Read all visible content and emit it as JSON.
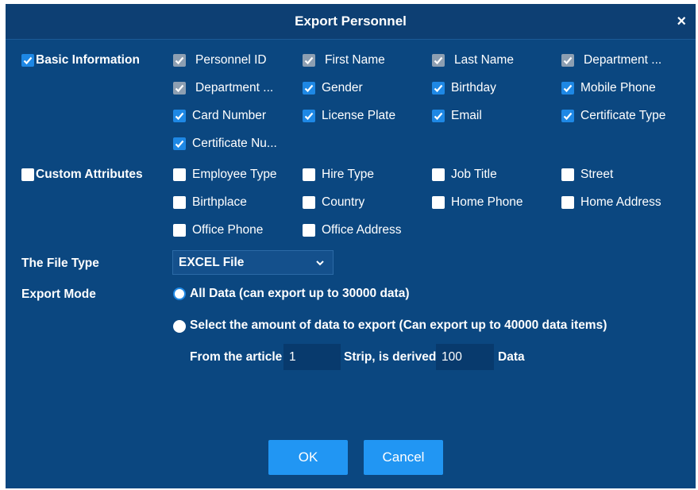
{
  "dialog": {
    "title": "Export Personnel",
    "close_symbol": "×"
  },
  "basic": {
    "label": "Basic Information",
    "checked": true,
    "fields": [
      {
        "label": "Personnel ID",
        "state": "disabled"
      },
      {
        "label": "First Name",
        "state": "disabled"
      },
      {
        "label": "Last Name",
        "state": "disabled"
      },
      {
        "label": "Department ...",
        "state": "disabled"
      },
      {
        "label": "Department ...",
        "state": "disabled"
      },
      {
        "label": "Gender",
        "state": "checked"
      },
      {
        "label": "Birthday",
        "state": "checked"
      },
      {
        "label": "Mobile Phone",
        "state": "checked"
      },
      {
        "label": "Card Number",
        "state": "checked"
      },
      {
        "label": "License Plate",
        "state": "checked"
      },
      {
        "label": "Email",
        "state": "checked"
      },
      {
        "label": "Certificate Type",
        "state": "checked"
      },
      {
        "label": "Certificate Nu...",
        "state": "checked"
      }
    ]
  },
  "custom": {
    "label": "Custom Attributes",
    "checked": false,
    "fields": [
      {
        "label": "Employee Type",
        "state": "unchecked"
      },
      {
        "label": "Hire Type",
        "state": "unchecked"
      },
      {
        "label": "Job Title",
        "state": "unchecked"
      },
      {
        "label": "Street",
        "state": "unchecked"
      },
      {
        "label": "Birthplace",
        "state": "unchecked"
      },
      {
        "label": "Country",
        "state": "unchecked"
      },
      {
        "label": "Home Phone",
        "state": "unchecked"
      },
      {
        "label": "Home Address",
        "state": "unchecked"
      },
      {
        "label": "Office Phone",
        "state": "unchecked"
      },
      {
        "label": "Office Address",
        "state": "unchecked"
      }
    ]
  },
  "file_type": {
    "label": "The File Type",
    "value": "EXCEL File",
    "icon": "chevron-down-icon"
  },
  "export_mode": {
    "label": "Export Mode",
    "options": [
      {
        "label": "All Data (can export up to 30000 data)",
        "selected": true
      },
      {
        "label": "Select the amount of data to export (Can export up to 40000 data items)",
        "selected": false
      }
    ],
    "range": {
      "from_label": "From the article",
      "from_value": "1",
      "mid_label": "Strip, is derived",
      "count_value": "100",
      "end_label": "Data"
    }
  },
  "buttons": {
    "ok": "OK",
    "cancel": "Cancel"
  },
  "colors": {
    "dialog_bg": "#0b4780",
    "accent": "#1e88e5",
    "button": "#2196f3"
  }
}
